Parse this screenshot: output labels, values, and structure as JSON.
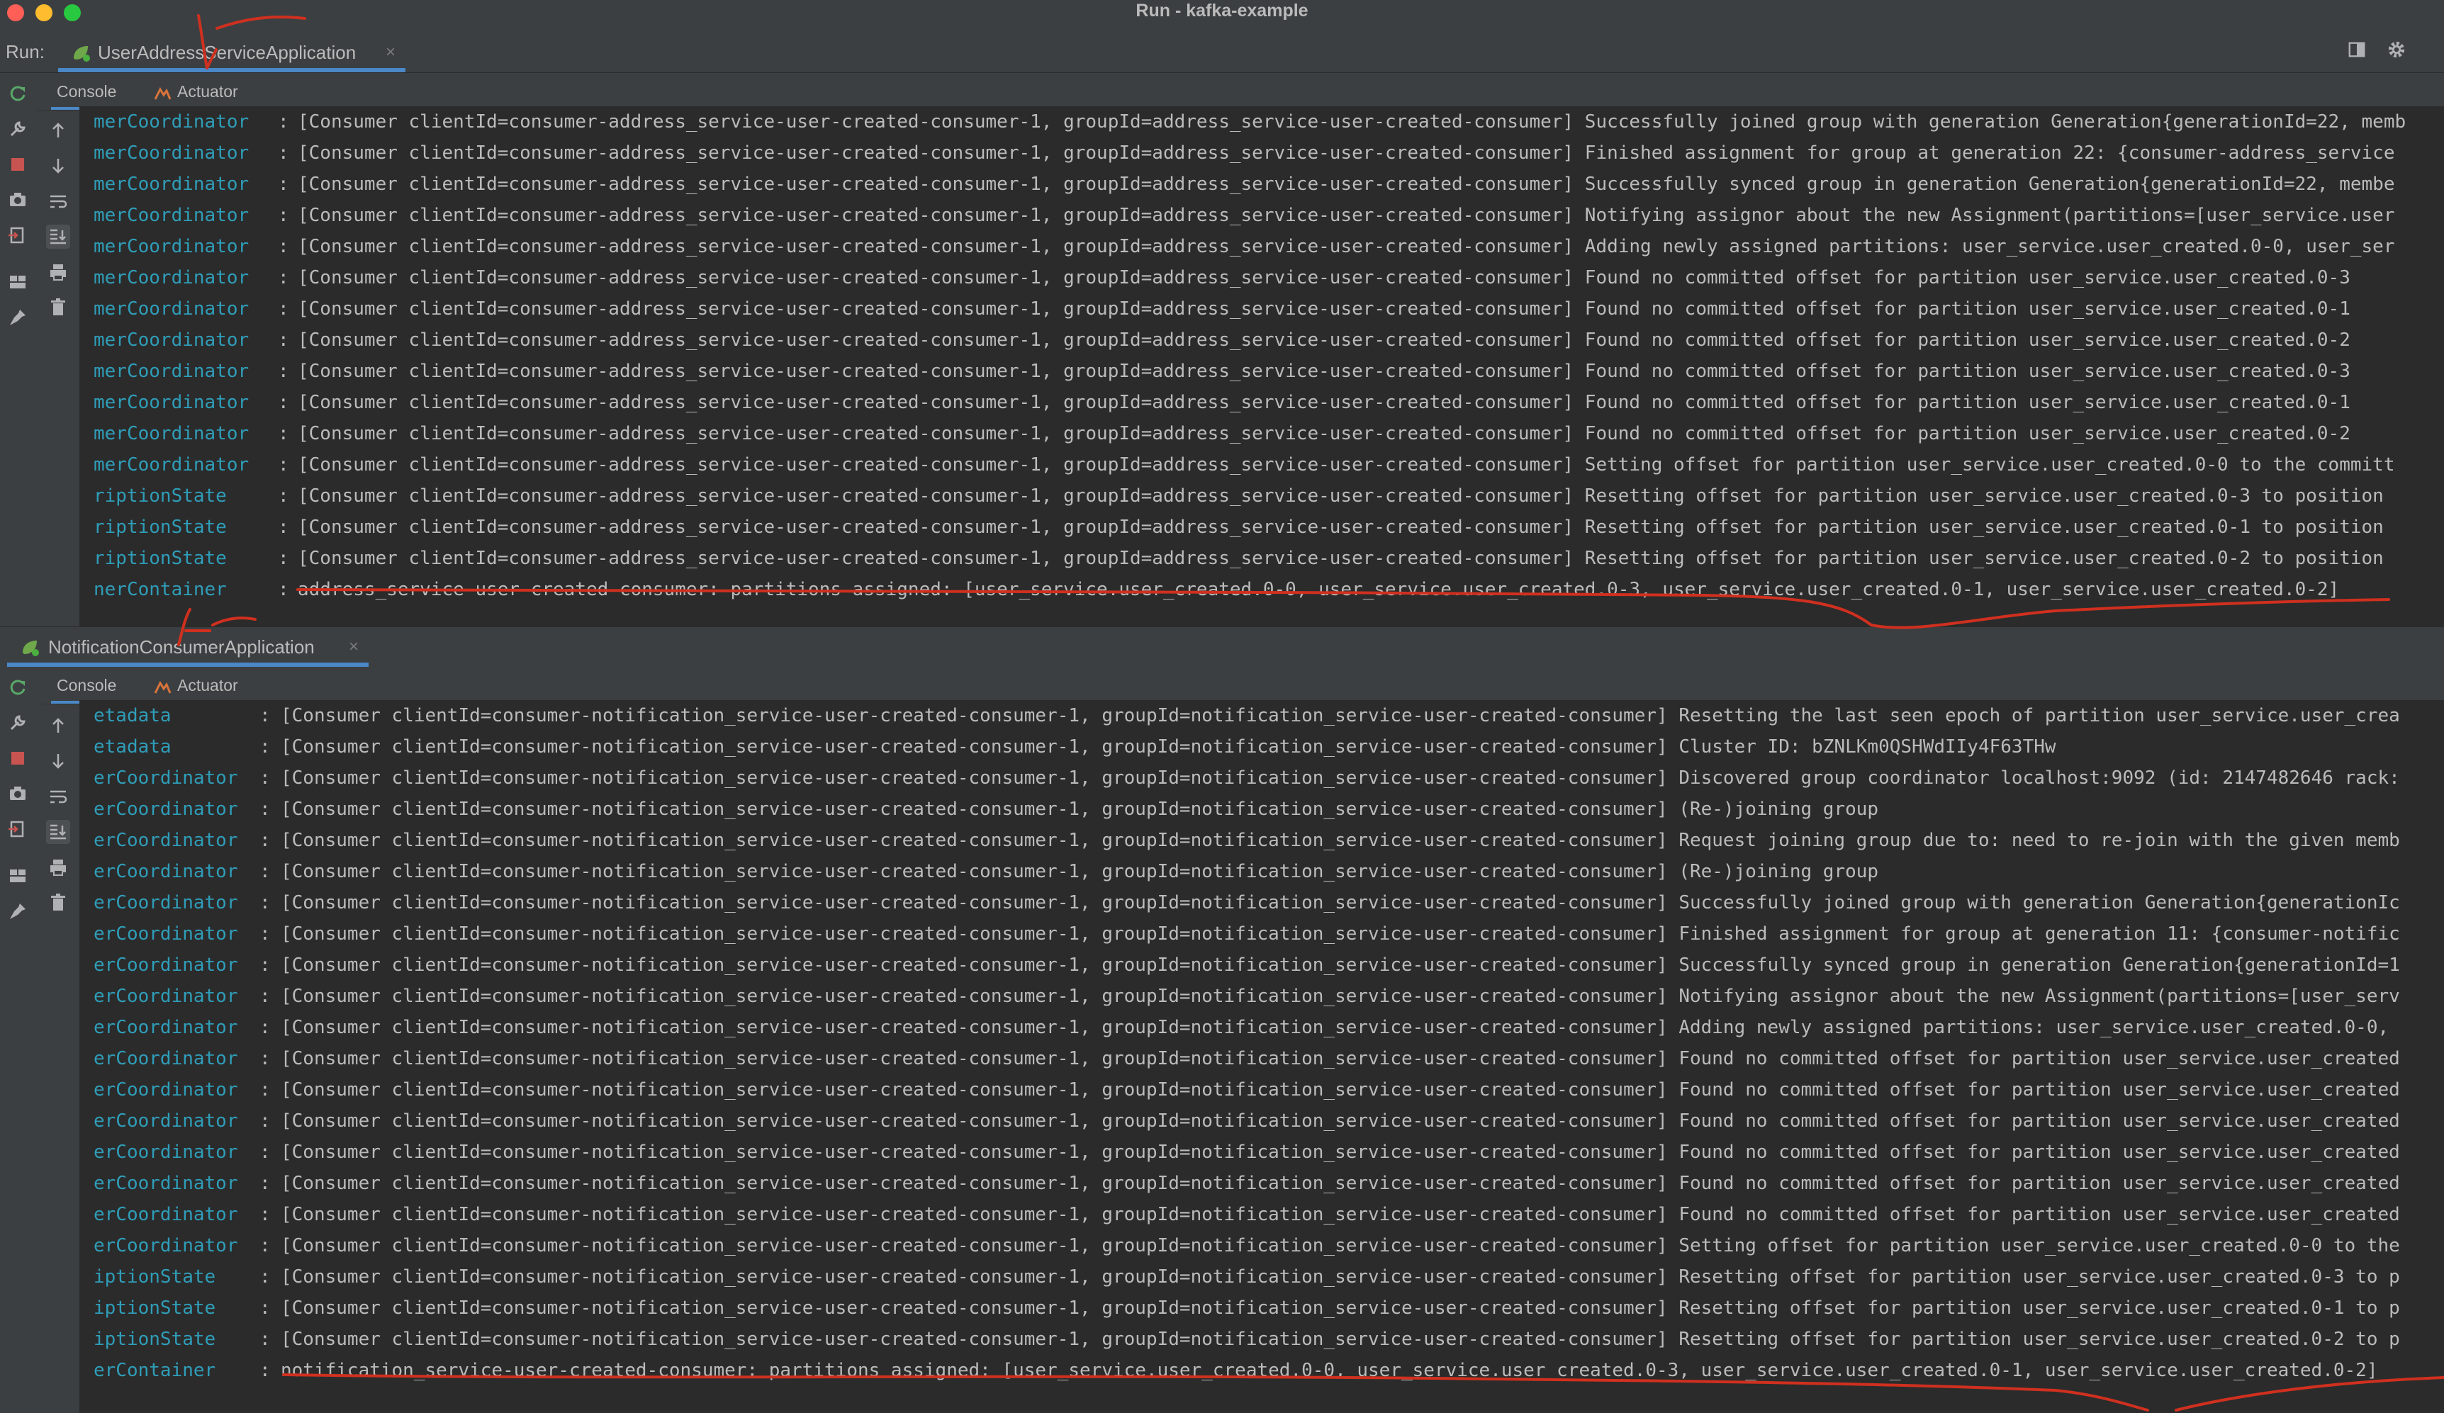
{
  "window": {
    "title": "Run - kafka-example"
  },
  "run": {
    "label": "Run:",
    "tabs": [
      {
        "label": "UserAddressServiceApplication",
        "close": "×"
      },
      {
        "label": "NotificationConsumerApplication",
        "close": "×"
      }
    ]
  },
  "subtabs": {
    "console": "Console",
    "actuator": "Actuator"
  },
  "colors": {
    "logger": "#2f9db8",
    "accent": "#4a88c7",
    "annotation": "#d0301f"
  },
  "console1": {
    "lines": [
      {
        "logger": "merCoordinator",
        "msg": "[Consumer clientId=consumer-address_service-user-created-consumer-1, groupId=address_service-user-created-consumer] Successfully joined group with generation Generation{generationId=22, memb"
      },
      {
        "logger": "merCoordinator",
        "msg": "[Consumer clientId=consumer-address_service-user-created-consumer-1, groupId=address_service-user-created-consumer] Finished assignment for group at generation 22: {consumer-address_service"
      },
      {
        "logger": "merCoordinator",
        "msg": "[Consumer clientId=consumer-address_service-user-created-consumer-1, groupId=address_service-user-created-consumer] Successfully synced group in generation Generation{generationId=22, membe"
      },
      {
        "logger": "merCoordinator",
        "msg": "[Consumer clientId=consumer-address_service-user-created-consumer-1, groupId=address_service-user-created-consumer] Notifying assignor about the new Assignment(partitions=[user_service.user"
      },
      {
        "logger": "merCoordinator",
        "msg": "[Consumer clientId=consumer-address_service-user-created-consumer-1, groupId=address_service-user-created-consumer] Adding newly assigned partitions: user_service.user_created.0-0, user_ser"
      },
      {
        "logger": "merCoordinator",
        "msg": "[Consumer clientId=consumer-address_service-user-created-consumer-1, groupId=address_service-user-created-consumer] Found no committed offset for partition user_service.user_created.0-3"
      },
      {
        "logger": "merCoordinator",
        "msg": "[Consumer clientId=consumer-address_service-user-created-consumer-1, groupId=address_service-user-created-consumer] Found no committed offset for partition user_service.user_created.0-1"
      },
      {
        "logger": "merCoordinator",
        "msg": "[Consumer clientId=consumer-address_service-user-created-consumer-1, groupId=address_service-user-created-consumer] Found no committed offset for partition user_service.user_created.0-2"
      },
      {
        "logger": "merCoordinator",
        "msg": "[Consumer clientId=consumer-address_service-user-created-consumer-1, groupId=address_service-user-created-consumer] Found no committed offset for partition user_service.user_created.0-3"
      },
      {
        "logger": "merCoordinator",
        "msg": "[Consumer clientId=consumer-address_service-user-created-consumer-1, groupId=address_service-user-created-consumer] Found no committed offset for partition user_service.user_created.0-1"
      },
      {
        "logger": "merCoordinator",
        "msg": "[Consumer clientId=consumer-address_service-user-created-consumer-1, groupId=address_service-user-created-consumer] Found no committed offset for partition user_service.user_created.0-2"
      },
      {
        "logger": "merCoordinator",
        "msg": "[Consumer clientId=consumer-address_service-user-created-consumer-1, groupId=address_service-user-created-consumer] Setting offset for partition user_service.user_created.0-0 to the committ"
      },
      {
        "logger": "riptionState",
        "msg": "[Consumer clientId=consumer-address_service-user-created-consumer-1, groupId=address_service-user-created-consumer] Resetting offset for partition user_service.user_created.0-3 to position"
      },
      {
        "logger": "riptionState",
        "msg": "[Consumer clientId=consumer-address_service-user-created-consumer-1, groupId=address_service-user-created-consumer] Resetting offset for partition user_service.user_created.0-1 to position"
      },
      {
        "logger": "riptionState",
        "msg": "[Consumer clientId=consumer-address_service-user-created-consumer-1, groupId=address_service-user-created-consumer] Resetting offset for partition user_service.user_created.0-2 to position"
      },
      {
        "logger": "nerContainer",
        "msg": "address_service-user-created-consumer: partitions assigned: [user_service.user_created.0-0, user_service.user_created.0-3, user_service.user_created.0-1, user_service.user_created.0-2]"
      }
    ]
  },
  "console2": {
    "lines": [
      {
        "logger": "etadata",
        "msg": "[Consumer clientId=consumer-notification_service-user-created-consumer-1, groupId=notification_service-user-created-consumer] Resetting the last seen epoch of partition user_service.user_crea"
      },
      {
        "logger": "etadata",
        "msg": "[Consumer clientId=consumer-notification_service-user-created-consumer-1, groupId=notification_service-user-created-consumer] Cluster ID: bZNLKm0QSHWdIIy4F63THw"
      },
      {
        "logger": "erCoordinator",
        "msg": "[Consumer clientId=consumer-notification_service-user-created-consumer-1, groupId=notification_service-user-created-consumer] Discovered group coordinator localhost:9092 (id: 2147482646 rack:"
      },
      {
        "logger": "erCoordinator",
        "msg": "[Consumer clientId=consumer-notification_service-user-created-consumer-1, groupId=notification_service-user-created-consumer] (Re-)joining group"
      },
      {
        "logger": "erCoordinator",
        "msg": "[Consumer clientId=consumer-notification_service-user-created-consumer-1, groupId=notification_service-user-created-consumer] Request joining group due to: need to re-join with the given memb"
      },
      {
        "logger": "erCoordinator",
        "msg": "[Consumer clientId=consumer-notification_service-user-created-consumer-1, groupId=notification_service-user-created-consumer] (Re-)joining group"
      },
      {
        "logger": "erCoordinator",
        "msg": "[Consumer clientId=consumer-notification_service-user-created-consumer-1, groupId=notification_service-user-created-consumer] Successfully joined group with generation Generation{generationIc"
      },
      {
        "logger": "erCoordinator",
        "msg": "[Consumer clientId=consumer-notification_service-user-created-consumer-1, groupId=notification_service-user-created-consumer] Finished assignment for group at generation 11: {consumer-notific"
      },
      {
        "logger": "erCoordinator",
        "msg": "[Consumer clientId=consumer-notification_service-user-created-consumer-1, groupId=notification_service-user-created-consumer] Successfully synced group in generation Generation{generationId=1"
      },
      {
        "logger": "erCoordinator",
        "msg": "[Consumer clientId=consumer-notification_service-user-created-consumer-1, groupId=notification_service-user-created-consumer] Notifying assignor about the new Assignment(partitions=[user_serv"
      },
      {
        "logger": "erCoordinator",
        "msg": "[Consumer clientId=consumer-notification_service-user-created-consumer-1, groupId=notification_service-user-created-consumer] Adding newly assigned partitions: user_service.user_created.0-0,"
      },
      {
        "logger": "erCoordinator",
        "msg": "[Consumer clientId=consumer-notification_service-user-created-consumer-1, groupId=notification_service-user-created-consumer] Found no committed offset for partition user_service.user_created"
      },
      {
        "logger": "erCoordinator",
        "msg": "[Consumer clientId=consumer-notification_service-user-created-consumer-1, groupId=notification_service-user-created-consumer] Found no committed offset for partition user_service.user_created"
      },
      {
        "logger": "erCoordinator",
        "msg": "[Consumer clientId=consumer-notification_service-user-created-consumer-1, groupId=notification_service-user-created-consumer] Found no committed offset for partition user_service.user_created"
      },
      {
        "logger": "erCoordinator",
        "msg": "[Consumer clientId=consumer-notification_service-user-created-consumer-1, groupId=notification_service-user-created-consumer] Found no committed offset for partition user_service.user_created"
      },
      {
        "logger": "erCoordinator",
        "msg": "[Consumer clientId=consumer-notification_service-user-created-consumer-1, groupId=notification_service-user-created-consumer] Found no committed offset for partition user_service.user_created"
      },
      {
        "logger": "erCoordinator",
        "msg": "[Consumer clientId=consumer-notification_service-user-created-consumer-1, groupId=notification_service-user-created-consumer] Found no committed offset for partition user_service.user_created"
      },
      {
        "logger": "erCoordinator",
        "msg": "[Consumer clientId=consumer-notification_service-user-created-consumer-1, groupId=notification_service-user-created-consumer] Setting offset for partition user_service.user_created.0-0 to the"
      },
      {
        "logger": "iptionState",
        "msg": "[Consumer clientId=consumer-notification_service-user-created-consumer-1, groupId=notification_service-user-created-consumer] Resetting offset for partition user_service.user_created.0-3 to p"
      },
      {
        "logger": "iptionState",
        "msg": "[Consumer clientId=consumer-notification_service-user-created-consumer-1, groupId=notification_service-user-created-consumer] Resetting offset for partition user_service.user_created.0-1 to p"
      },
      {
        "logger": "iptionState",
        "msg": "[Consumer clientId=consumer-notification_service-user-created-consumer-1, groupId=notification_service-user-created-consumer] Resetting offset for partition user_service.user_created.0-2 to p"
      },
      {
        "logger": "erContainer",
        "msg": "notification_service-user-created-consumer: partitions assigned: [user_service.user_created.0-0, user_service.user_created.0-3, user_service.user_created.0-1, user_service.user_created.0-2]"
      }
    ]
  }
}
